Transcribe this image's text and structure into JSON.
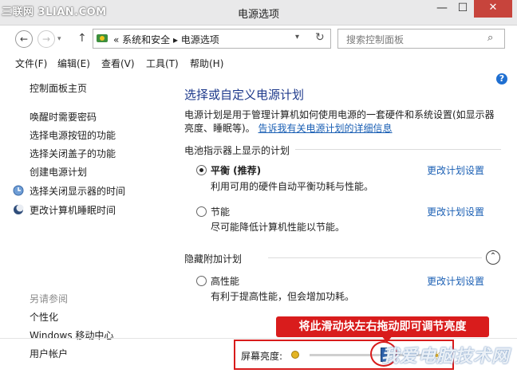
{
  "window": {
    "title": "电源选项",
    "watermark": "三联网 3LIAN.COM",
    "minimize": "—",
    "maximize": "☐",
    "close": "✕"
  },
  "address_bar": {
    "back": "←",
    "forward": "→",
    "up": "↑",
    "path": "« 系统和安全 ▸ 电源选项",
    "dropdown": "▾",
    "refresh": "↻",
    "search_placeholder": "搜索控制面板",
    "search_icon": "⌕"
  },
  "menu": [
    "文件(F)",
    "编辑(E)",
    "查看(V)",
    "工具(T)",
    "帮助(H)"
  ],
  "sidebar": {
    "home": "控制面板主页",
    "links": [
      "唤醒时需要密码",
      "选择电源按钮的功能",
      "选择关闭盖子的功能",
      "创建电源计划",
      "选择关闭显示器的时间",
      "更改计算机睡眠时间"
    ],
    "see_also_title": "另请参阅",
    "see_also": [
      "个性化",
      "Windows 移动中心",
      "用户帐户"
    ]
  },
  "main": {
    "help": "?",
    "title": "选择或自定义电源计划",
    "description": "电源计划是用于管理计算机如何使用电源的一套硬件和系统设置(如显示器亮度、睡眠等)。",
    "description_link": "告诉我有关电源计划的详细信息",
    "battery_section": "电池指示器上显示的计划",
    "hidden_section": "隐藏附加计划",
    "collapse": "⌃",
    "plans": [
      {
        "name": "平衡 (推荐)",
        "desc": "利用可用的硬件自动平衡功耗与性能。",
        "selected": true,
        "link": "更改计划设置"
      },
      {
        "name": "节能",
        "desc": "尽可能降低计算机性能以节能。",
        "selected": false,
        "link": "更改计划设置"
      },
      {
        "name": "高性能",
        "desc": "有利于提高性能，但会增加功耗。",
        "selected": false,
        "link": "更改计划设置"
      }
    ]
  },
  "brightness": {
    "label": "屏幕亮度:",
    "level": 0.62,
    "callout": "将此滑动块左右拖动即可调节亮度",
    "bright_icon": "☀"
  },
  "watermark_br": "我爱电脑技术网",
  "colors": {
    "accent": "#1a5fb4",
    "title": "#1e3a8c",
    "annotation_red": "#d81b1b",
    "close_button": "#c7443c"
  }
}
